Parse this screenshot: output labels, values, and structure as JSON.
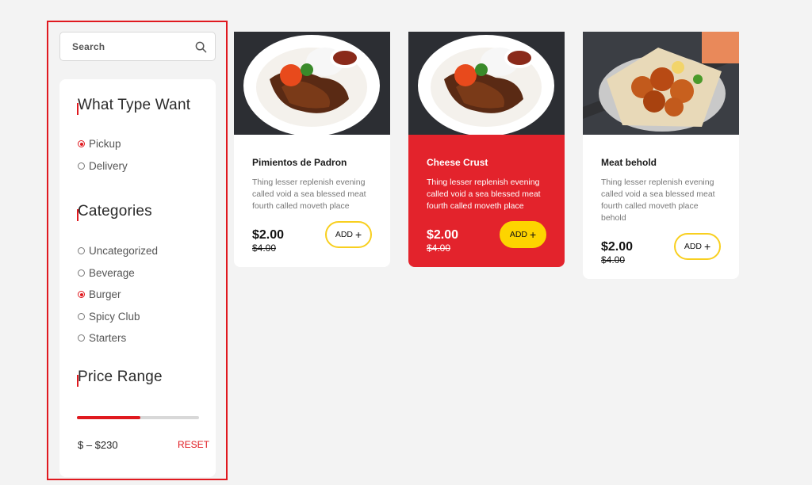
{
  "search": {
    "placeholder": "Search",
    "icon": "search-icon"
  },
  "filters": {
    "type_title": "What Type Want",
    "types": [
      {
        "label": "Pickup",
        "selected": true
      },
      {
        "label": "Delivery",
        "selected": false
      }
    ],
    "categories_title": "Categories",
    "categories": [
      {
        "label": "Uncategorized",
        "selected": false
      },
      {
        "label": "Beverage",
        "selected": false
      },
      {
        "label": "Burger",
        "selected": true
      },
      {
        "label": "Spicy Club",
        "selected": false
      },
      {
        "label": "Starters",
        "selected": false
      }
    ],
    "price_title": "Price Range",
    "price_label": "$ – $230",
    "price_fill_fraction": 0.52,
    "reset_label": "RESET"
  },
  "products": [
    {
      "name": "Pimientos de Padron",
      "desc": "Thing lesser replenish evening called void a sea blessed meat fourth called moveth place",
      "price": "$2.00",
      "old_price": "$4.00",
      "add_label": "ADD",
      "add_icon": "+",
      "image": "grilled-meat-plate"
    },
    {
      "name": "Cheese Crust",
      "desc": "Thing lesser replenish evening called void a sea blessed meat fourth called moveth place",
      "price": "$2.00",
      "old_price": "$4.00",
      "add_label": "ADD",
      "add_icon": "+",
      "image": "grilled-meat-plate",
      "highlighted": true
    },
    {
      "name": "Meat behold",
      "desc": "Thing lesser replenish evening called void a sea blessed meat fourth called moveth place behold",
      "price": "$2.00",
      "old_price": "$4.00",
      "add_label": "ADD",
      "add_icon": "+",
      "image": "fried-chicken-pan"
    }
  ],
  "colors": {
    "accent": "#e0191f",
    "card_highlight": "#e3232c",
    "button_yellow": "#fdd400",
    "background": "#f3f3f3"
  }
}
